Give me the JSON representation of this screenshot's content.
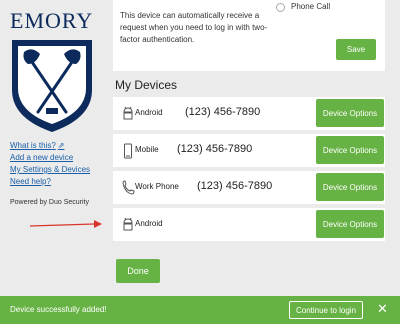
{
  "brand": {
    "name": "EMORY",
    "navy": "#0c2a5b",
    "accent_green": "#67b244"
  },
  "sidebar": {
    "links": [
      {
        "label": "What is this?",
        "icon": "external-link-icon"
      },
      {
        "label": "Add a new device"
      },
      {
        "label": "My Settings & Devices"
      },
      {
        "label": "Need help?"
      }
    ],
    "powered_by": "Powered by Duo Security"
  },
  "auto_request": {
    "description": "This device can automatically receive a request when you need to log in with two-factor authentication.",
    "option_label": "Phone Call",
    "save_label": "Save"
  },
  "devices_section": {
    "title": "My Devices",
    "devices": [
      {
        "icon": "android-icon",
        "name": "Android",
        "phone": "(123) 456-7890",
        "button": "Device Options"
      },
      {
        "icon": "mobile-phone-icon",
        "name": "Mobile",
        "phone": "(123) 456-7890",
        "button": "Device Options"
      },
      {
        "icon": "phone-handset-icon",
        "name": "Work Phone",
        "phone": "(123) 456-7890",
        "button": "Device Options"
      },
      {
        "icon": "android-icon",
        "name": "Android",
        "phone": "",
        "button": "Device Options"
      }
    ]
  },
  "done_label": "Done",
  "banner": {
    "message": "Device successfully added!",
    "continue_label": "Continue to login",
    "close_icon": "close-icon"
  }
}
